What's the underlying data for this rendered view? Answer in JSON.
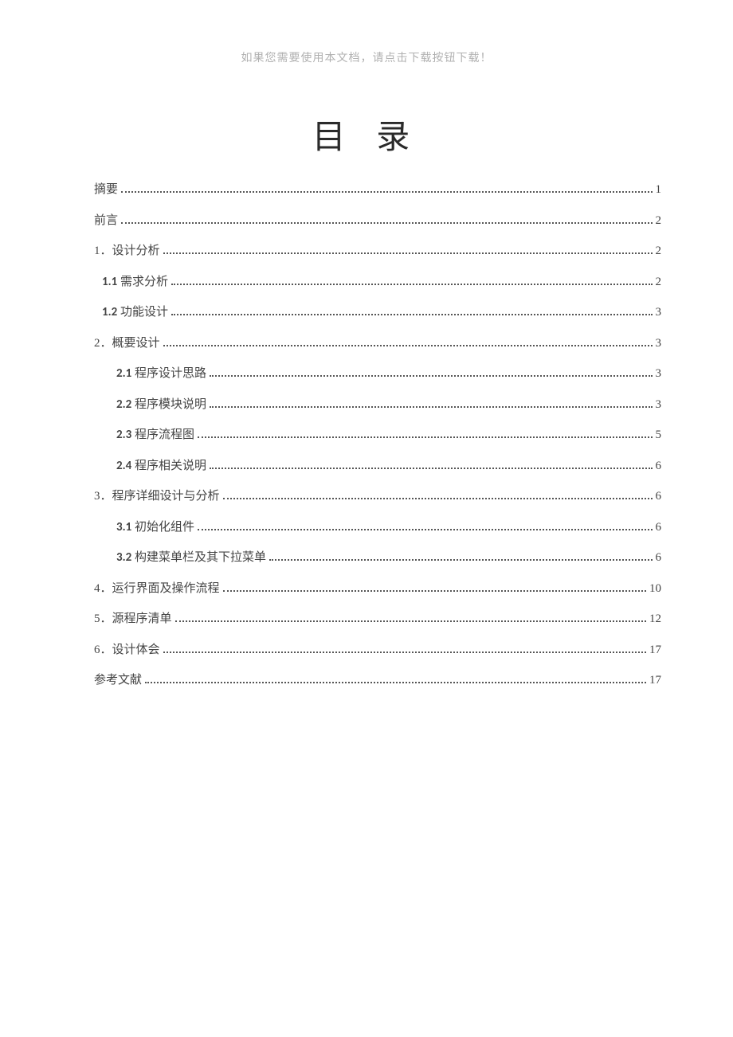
{
  "header_note": "如果您需要使用本文档，请点击下载按钮下载！",
  "title": "目 录",
  "toc": [
    {
      "label": "摘要",
      "page": "1",
      "indent": 0
    },
    {
      "label": "前言",
      "page": "2",
      "indent": 0
    },
    {
      "label": "1．设计分析",
      "page": "2",
      "indent": 0
    },
    {
      "num": "1.1",
      "label": " 需求分析",
      "page": "2",
      "indent": 1
    },
    {
      "num": "1.2",
      "label": " 功能设计",
      "page": "3",
      "indent": 1
    },
    {
      "label": "2．概要设计",
      "page": "3",
      "indent": 0
    },
    {
      "num": "2.1",
      "label": " 程序设计思路",
      "page": "3",
      "indent": 2
    },
    {
      "num": "2.2",
      "label": " 程序模块说明",
      "page": "3",
      "indent": 2
    },
    {
      "num": "2.3",
      "label": " 程序流程图",
      "page": "5",
      "indent": 2
    },
    {
      "num": "2.4",
      "label": "  程序相关说明",
      "page": "6",
      "indent": 2
    },
    {
      "label": "3．程序详细设计与分析",
      "page": "6",
      "indent": 0
    },
    {
      "num": "3.1",
      "label": "  初始化组件",
      "page": "6",
      "indent": 2
    },
    {
      "num": "3.2",
      "label": " 构建菜单栏及其下拉菜单",
      "page": "6",
      "indent": 2
    },
    {
      "label": "4．运行界面及操作流程",
      "page": "10",
      "indent": 0
    },
    {
      "label": "5．源程序清单",
      "page": "12",
      "indent": 0
    },
    {
      "label": "6．设计体会",
      "page": "17",
      "indent": 0
    },
    {
      "label": "参考文献",
      "page": "17",
      "indent": 0
    }
  ]
}
